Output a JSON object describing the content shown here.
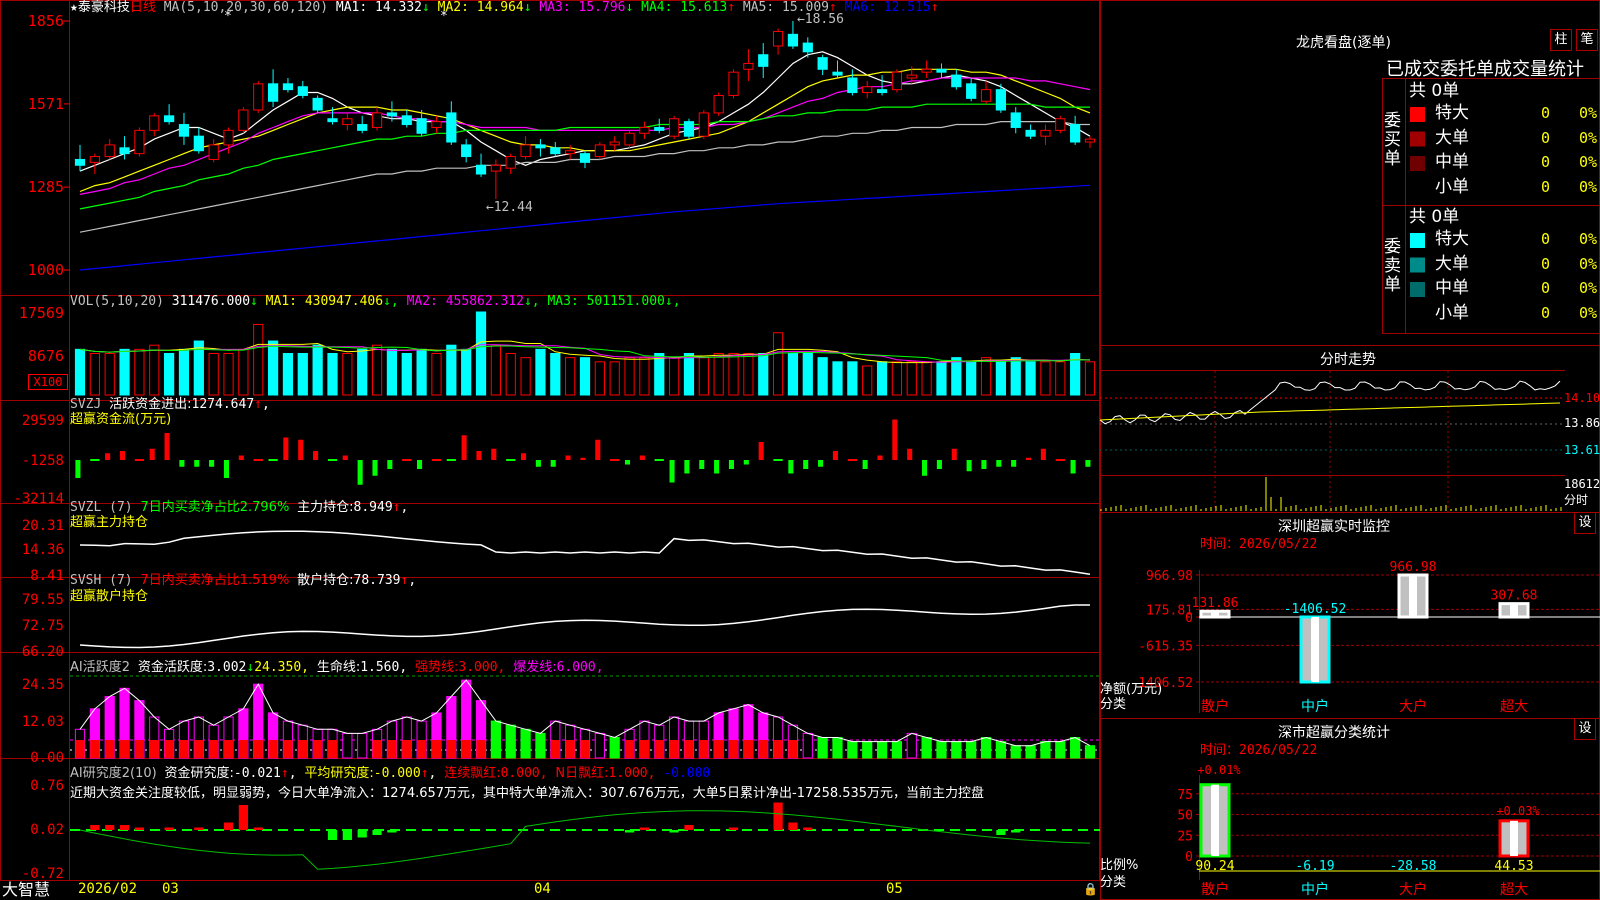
{
  "stock": {
    "name": "泰豪科技",
    "star": "★",
    "period": "日线"
  },
  "main_chart": {
    "ma_label": "MA(5,10,20,30,60,120)",
    "ma": [
      {
        "label": "MA1:",
        "value": "14.332",
        "arrow": "↓",
        "color": "#ffffff"
      },
      {
        "label": "MA2:",
        "value": "14.964",
        "arrow": "↓",
        "color": "#ffff00"
      },
      {
        "label": "MA3:",
        "value": "15.796",
        "arrow": "↓",
        "color": "#ff00ff"
      },
      {
        "label": "MA4:",
        "value": "15.613",
        "arrow": "↑",
        "color": "#00ff00"
      },
      {
        "label": "MA5:",
        "value": "15.009",
        "arrow": "↑",
        "color": "#c0c0c0"
      },
      {
        "label": "MA6:",
        "value": "12.515",
        "arrow": "↑",
        "color": "#0000ff"
      }
    ],
    "y_ticks": [
      "1856",
      "1571",
      "1285",
      "1000"
    ],
    "high_label": "18.56",
    "low_label": "12.44",
    "candles": [
      [
        13.8,
        14.3,
        13.4,
        13.6
      ],
      [
        13.7,
        14.0,
        13.3,
        13.9
      ],
      [
        13.9,
        14.5,
        13.8,
        14.3
      ],
      [
        14.2,
        14.6,
        13.8,
        14.0
      ],
      [
        14.0,
        14.9,
        13.9,
        14.8
      ],
      [
        14.8,
        15.4,
        14.6,
        15.3
      ],
      [
        15.3,
        15.7,
        15.0,
        15.1
      ],
      [
        15.0,
        15.4,
        14.3,
        14.6
      ],
      [
        14.6,
        14.9,
        14.0,
        14.1
      ],
      [
        13.8,
        14.5,
        13.7,
        14.3
      ],
      [
        14.3,
        14.9,
        14.0,
        14.8
      ],
      [
        14.8,
        15.6,
        14.7,
        15.5
      ],
      [
        15.5,
        16.5,
        15.4,
        16.4
      ],
      [
        16.4,
        16.9,
        15.6,
        15.8
      ],
      [
        16.4,
        16.6,
        16.1,
        16.2
      ],
      [
        16.3,
        16.5,
        15.9,
        16.0
      ],
      [
        15.9,
        16.0,
        15.4,
        15.5
      ],
      [
        15.2,
        15.6,
        15.0,
        15.1
      ],
      [
        15.0,
        15.4,
        14.8,
        15.2
      ],
      [
        15.0,
        15.3,
        14.7,
        14.8
      ],
      [
        14.9,
        15.6,
        14.8,
        15.4
      ],
      [
        15.4,
        15.8,
        15.1,
        15.3
      ],
      [
        15.3,
        15.5,
        14.9,
        15.0
      ],
      [
        15.2,
        15.5,
        14.6,
        14.7
      ],
      [
        14.9,
        15.3,
        14.7,
        15.1
      ],
      [
        15.4,
        15.8,
        14.3,
        14.4
      ],
      [
        14.3,
        14.5,
        13.7,
        13.9
      ],
      [
        13.6,
        14.0,
        13.2,
        13.3
      ],
      [
        13.4,
        13.8,
        12.44,
        13.6
      ],
      [
        13.5,
        14.0,
        13.3,
        13.9
      ],
      [
        13.9,
        14.6,
        13.8,
        14.3
      ],
      [
        14.3,
        14.5,
        13.9,
        14.2
      ],
      [
        14.2,
        14.4,
        13.9,
        14.0
      ],
      [
        14.0,
        14.3,
        13.8,
        14.1
      ],
      [
        14.0,
        14.1,
        13.5,
        13.7
      ],
      [
        13.9,
        14.4,
        13.8,
        14.3
      ],
      [
        14.3,
        14.6,
        14.1,
        14.4
      ],
      [
        14.3,
        14.8,
        14.2,
        14.7
      ],
      [
        14.7,
        15.1,
        14.5,
        14.9
      ],
      [
        14.9,
        15.2,
        14.7,
        14.8
      ],
      [
        14.6,
        15.3,
        14.5,
        15.2
      ],
      [
        15.1,
        15.2,
        14.5,
        14.6
      ],
      [
        14.6,
        15.5,
        14.5,
        15.4
      ],
      [
        15.4,
        16.1,
        15.3,
        16.0
      ],
      [
        16.0,
        16.9,
        15.9,
        16.8
      ],
      [
        16.9,
        17.6,
        16.5,
        17.1
      ],
      [
        17.4,
        17.8,
        16.6,
        17.0
      ],
      [
        17.7,
        18.3,
        17.4,
        18.2
      ],
      [
        18.1,
        18.56,
        17.6,
        17.7
      ],
      [
        17.8,
        18.0,
        17.3,
        17.5
      ],
      [
        17.3,
        17.4,
        16.7,
        16.9
      ],
      [
        16.8,
        17.2,
        16.6,
        16.7
      ],
      [
        16.6,
        16.9,
        16.0,
        16.1
      ],
      [
        16.1,
        16.5,
        15.9,
        16.3
      ],
      [
        16.2,
        16.7,
        16.0,
        16.1
      ],
      [
        16.2,
        16.9,
        16.1,
        16.8
      ],
      [
        16.6,
        17.0,
        16.4,
        16.7
      ],
      [
        16.8,
        17.2,
        16.6,
        16.9
      ],
      [
        16.9,
        17.1,
        16.6,
        16.8
      ],
      [
        16.7,
        16.9,
        16.2,
        16.3
      ],
      [
        16.4,
        16.6,
        15.8,
        15.9
      ],
      [
        15.8,
        16.5,
        15.7,
        16.2
      ],
      [
        16.2,
        16.4,
        15.4,
        15.5
      ],
      [
        15.4,
        15.6,
        14.7,
        14.9
      ],
      [
        14.8,
        15.0,
        14.5,
        14.6
      ],
      [
        14.6,
        15.0,
        14.3,
        14.8
      ],
      [
        14.8,
        15.3,
        14.7,
        15.2
      ],
      [
        15.0,
        15.3,
        14.3,
        14.4
      ],
      [
        14.4,
        14.6,
        14.2,
        14.5
      ]
    ],
    "ma_lines": [
      [
        13.4,
        13.6,
        13.8,
        14.0,
        14.2,
        14.5,
        14.7,
        14.9,
        14.9,
        14.7,
        14.5,
        14.7,
        15.1,
        15.5,
        15.8,
        16.1,
        16.1,
        15.9,
        15.6,
        15.4,
        15.3,
        15.2,
        15.2,
        15.1,
        15.1,
        15.1,
        14.8,
        14.4,
        14.1,
        13.8,
        13.6,
        13.8,
        13.9,
        14.0,
        14.1,
        14.1,
        14.1,
        14.2,
        14.3,
        14.5,
        14.7,
        14.8,
        14.9,
        15.1,
        15.4,
        15.7,
        16.1,
        16.6,
        17.1,
        17.4,
        17.5,
        17.3,
        17.0,
        16.7,
        16.5,
        16.4,
        16.4,
        16.5,
        16.6,
        16.7,
        16.6,
        16.5,
        16.3,
        16.0,
        15.7,
        15.4,
        15.1,
        14.9,
        14.6
      ],
      [
        12.7,
        12.9,
        13.0,
        13.2,
        13.4,
        13.6,
        13.8,
        14.0,
        14.2,
        14.3,
        14.4,
        14.5,
        14.6,
        14.8,
        15.0,
        15.2,
        15.4,
        15.5,
        15.6,
        15.6,
        15.6,
        15.5,
        15.5,
        15.4,
        15.3,
        15.2,
        15.0,
        14.8,
        14.6,
        14.4,
        14.3,
        14.3,
        14.2,
        14.2,
        14.1,
        14.1,
        14.1,
        14.1,
        14.2,
        14.3,
        14.4,
        14.5,
        14.6,
        14.7,
        14.9,
        15.1,
        15.4,
        15.7,
        16.0,
        16.3,
        16.5,
        16.6,
        16.7,
        16.7,
        16.8,
        16.8,
        16.9,
        16.9,
        16.9,
        16.9,
        16.8,
        16.8,
        16.7,
        16.5,
        16.3,
        16.1,
        15.9,
        15.6,
        15.4
      ],
      [
        12.6,
        12.7,
        12.8,
        13.0,
        13.1,
        13.3,
        13.5,
        13.6,
        13.8,
        14.0,
        14.2,
        14.4,
        14.7,
        14.9,
        15.1,
        15.3,
        15.4,
        15.4,
        15.4,
        15.4,
        15.4,
        15.3,
        15.2,
        15.2,
        15.1,
        15.1,
        15.0,
        14.9,
        14.9,
        14.9,
        14.9,
        14.8,
        14.8,
        14.8,
        14.8,
        14.8,
        14.8,
        14.8,
        14.8,
        14.8,
        14.9,
        14.9,
        14.9,
        15.0,
        15.0,
        15.1,
        15.2,
        15.4,
        15.6,
        15.8,
        15.9,
        16.1,
        16.2,
        16.3,
        16.3,
        16.4,
        16.5,
        16.5,
        16.6,
        16.6,
        16.6,
        16.6,
        16.6,
        16.6,
        16.5,
        16.5,
        16.4,
        16.3,
        16.2
      ],
      [
        12.1,
        12.2,
        12.3,
        12.4,
        12.5,
        12.7,
        12.8,
        12.9,
        13.1,
        13.2,
        13.3,
        13.5,
        13.6,
        13.8,
        13.9,
        14.0,
        14.1,
        14.2,
        14.3,
        14.4,
        14.5,
        14.5,
        14.6,
        14.6,
        14.7,
        14.7,
        14.8,
        14.8,
        14.8,
        14.8,
        14.8,
        14.8,
        14.8,
        14.9,
        14.9,
        14.9,
        14.9,
        14.9,
        14.9,
        15.0,
        15.0,
        15.0,
        15.0,
        15.1,
        15.1,
        15.1,
        15.2,
        15.3,
        15.3,
        15.4,
        15.4,
        15.5,
        15.5,
        15.5,
        15.6,
        15.6,
        15.6,
        15.7,
        15.7,
        15.7,
        15.7,
        15.7,
        15.7,
        15.7,
        15.7,
        15.6,
        15.6,
        15.6,
        15.6
      ],
      [
        11.3,
        11.4,
        11.5,
        11.6,
        11.7,
        11.8,
        11.9,
        12.0,
        12.1,
        12.2,
        12.3,
        12.4,
        12.5,
        12.6,
        12.7,
        12.8,
        12.9,
        13.0,
        13.1,
        13.2,
        13.3,
        13.3,
        13.4,
        13.4,
        13.5,
        13.5,
        13.5,
        13.6,
        13.6,
        13.6,
        13.7,
        13.7,
        13.7,
        13.8,
        13.8,
        13.8,
        13.9,
        13.9,
        13.9,
        14.0,
        14.0,
        14.1,
        14.1,
        14.2,
        14.2,
        14.3,
        14.3,
        14.4,
        14.4,
        14.5,
        14.6,
        14.6,
        14.7,
        14.7,
        14.8,
        14.8,
        14.9,
        14.9,
        14.9,
        15.0,
        15.0,
        15.0,
        15.1,
        15.1,
        15.1,
        15.1,
        15.1,
        15.0,
        15.0
      ],
      [
        10.0,
        10.05,
        10.1,
        10.15,
        10.2,
        10.25,
        10.3,
        10.35,
        10.4,
        10.45,
        10.5,
        10.55,
        10.6,
        10.65,
        10.7,
        10.75,
        10.8,
        10.85,
        10.9,
        10.95,
        11.0,
        11.05,
        11.1,
        11.15,
        11.2,
        11.25,
        11.3,
        11.35,
        11.4,
        11.45,
        11.5,
        11.55,
        11.6,
        11.65,
        11.7,
        11.75,
        11.8,
        11.85,
        11.9,
        11.95,
        12.0,
        12.04,
        12.08,
        12.12,
        12.16,
        12.2,
        12.24,
        12.28,
        12.31,
        12.34,
        12.37,
        12.4,
        12.43,
        12.46,
        12.49,
        12.52,
        12.55,
        12.58,
        12.61,
        12.64,
        12.67,
        12.7,
        12.73,
        12.76,
        12.79,
        12.82,
        12.85,
        12.88,
        12.91
      ]
    ]
  },
  "volume_panel": {
    "title": "VOL(5,10,20)",
    "value": "311476.000",
    "arrow": "↓",
    "ma": [
      {
        "label": "MA1:",
        "value": "430947.406",
        "arrow": "↓",
        "color": "#ffff00"
      },
      {
        "label": "MA2:",
        "value": "455862.312",
        "arrow": "↓",
        "color": "#ff00ff"
      },
      {
        "label": "MA3:",
        "value": "501151.000",
        "arrow": "↓",
        "color": "#00ff00"
      }
    ],
    "y_ticks": [
      "17569",
      "8676"
    ],
    "unit_badge": "X100",
    "bars": [
      0.55,
      0.5,
      0.5,
      0.55,
      0.55,
      0.6,
      0.5,
      0.55,
      0.65,
      0.5,
      0.5,
      0.55,
      0.85,
      0.65,
      0.5,
      0.5,
      0.6,
      0.5,
      0.5,
      0.55,
      0.6,
      0.55,
      0.5,
      0.55,
      0.5,
      0.6,
      0.55,
      1.0,
      0.6,
      0.5,
      0.45,
      0.55,
      0.5,
      0.45,
      0.45,
      0.4,
      0.4,
      0.45,
      0.45,
      0.5,
      0.45,
      0.5,
      0.45,
      0.5,
      0.5,
      0.5,
      0.5,
      0.75,
      0.5,
      0.5,
      0.45,
      0.4,
      0.4,
      0.35,
      0.4,
      0.4,
      0.4,
      0.4,
      0.4,
      0.45,
      0.4,
      0.45,
      0.4,
      0.45,
      0.4,
      0.4,
      0.4,
      0.5,
      0.4
    ]
  },
  "svzj_panel": {
    "title": "SVZJ",
    "line1": "活跃资金进出:",
    "value": "1274.647",
    "arrow": "↑",
    "subtitle": "超赢资金流(万元)",
    "y_ticks": [
      "29599",
      "-1258",
      "-32114"
    ],
    "bars": [
      -0.4,
      0.0,
      0.15,
      0.2,
      0.0,
      0.25,
      0.6,
      -0.15,
      -0.15,
      -0.15,
      -0.4,
      0.1,
      0.0,
      0.0,
      0.5,
      0.45,
      0.2,
      0.0,
      0.1,
      -0.55,
      -0.35,
      -0.2,
      0.0,
      -0.2,
      0.0,
      0.0,
      0.55,
      0.2,
      0.25,
      0.0,
      0.15,
      -0.15,
      -0.15,
      0.1,
      0.05,
      0.45,
      0.0,
      -0.1,
      0.1,
      0.0,
      -0.5,
      -0.3,
      -0.2,
      -0.3,
      -0.2,
      -0.1,
      0.4,
      0.0,
      -0.3,
      -0.2,
      -0.15,
      0.2,
      0.0,
      -0.2,
      0.1,
      0.9,
      0.25,
      -0.35,
      -0.2,
      0.25,
      -0.25,
      -0.2,
      -0.15,
      -0.15,
      0.05,
      0.25,
      0.0,
      -0.3,
      -0.15,
      0.0,
      -0.2,
      -0.15,
      0.1,
      -0.1
    ]
  },
  "svzl_panel": {
    "title": "SVZL (7)",
    "desc": "7日内买卖净占比2.796%",
    "label": "主力持仓:",
    "value": "8.949",
    "arrow": "↑",
    "subtitle": "超赢主力持仓",
    "y_ticks": [
      "20.31",
      "14.36",
      "8.41"
    ]
  },
  "svsh_panel": {
    "title": "SVSH (7)",
    "desc": "7日内买卖净占比1.519%",
    "label": "散户持仓:",
    "value": "78.739",
    "arrow": "↑",
    "subtitle": "超赢散户持仓",
    "y_ticks": [
      "79.55",
      "72.75",
      "66.20"
    ]
  },
  "ai_activity_panel": {
    "title": "AI活跃度2",
    "label": "资金活跃度:",
    "value": "3.002",
    "arrow": "↓",
    "v2": "24.350,",
    "life_label": "生命线:",
    "life_value": "1.560,",
    "strong_label": "强势线:",
    "strong_value": "3.000,",
    "burst_label": "爆发线:",
    "burst_value": "6.000,",
    "y_ticks": [
      "24.35",
      "12.03",
      "0.00"
    ]
  },
  "ai_research_panel": {
    "title": "AI研究度2(10)",
    "label": "资金研究度:",
    "value": "-0.021",
    "arrow": "↑",
    "avg_label": "平均研究度:",
    "avg_value": "-0.000",
    "red_label": "连续飘红:",
    "red_value": "0.000,",
    "nred_label": "N日飘红:",
    "nred_value": "1.000,",
    "extra_value": "-0.000",
    "comment": "近期大资金关注度较低，明显弱势，今日大单净流入：1274.657万元，其中特大单净流入：307.676万元，大单5日累计净出-17258.535万元，当前主力控盘",
    "y_ticks": [
      "0.76",
      "0.02",
      "-0.72"
    ]
  },
  "footer": {
    "brand": "大智慧",
    "dates": [
      "2026/02",
      "03",
      "04",
      "05"
    ]
  },
  "lhb": {
    "title": "龙虎看盘(逐单)",
    "btn_zhu": "柱",
    "btn_bi": "笔",
    "tabs": "已成交委托单成交量统计",
    "buy_label": "委买单",
    "sell_label": "委卖单",
    "buy_total": "共 0单",
    "sell_total": "共 0单",
    "buy_rows": [
      {
        "label": "特大",
        "value": "0",
        "pct": "0%",
        "color": "#ff0000"
      },
      {
        "label": "大单",
        "value": "0",
        "pct": "0%",
        "color": "#a00000"
      },
      {
        "label": "中单",
        "value": "0",
        "pct": "0%",
        "color": "#700000"
      },
      {
        "label": "小单",
        "value": "0",
        "pct": "0%",
        "color": ""
      }
    ],
    "sell_rows": [
      {
        "label": "特大",
        "value": "0",
        "pct": "0%",
        "color": "#00ffff"
      },
      {
        "label": "大单",
        "value": "0",
        "pct": "0%",
        "color": "#008b8b"
      },
      {
        "label": "中单",
        "value": "0",
        "pct": "0%",
        "color": "#006b6b"
      },
      {
        "label": "小单",
        "value": "0",
        "pct": "0%",
        "color": ""
      }
    ]
  },
  "intraday": {
    "title": "分时走势",
    "ticks": [
      "14.10",
      "13.86",
      "13.61",
      "18612",
      "分时"
    ]
  },
  "sz_monitor": {
    "title": "深圳超赢实时监控",
    "settings_label": "设",
    "time_label": "时间：",
    "date": "2026/05/22",
    "y_ticks": [
      "966.98",
      "175.81",
      "0",
      "-615.35",
      "-1406.52"
    ],
    "axis_label_1": "净额(万元)",
    "axis_label_2": "分类",
    "categories": [
      "散户",
      "中户",
      "大户",
      "超大"
    ],
    "values": [
      131.86,
      -1406.52,
      966.98,
      307.68
    ],
    "value_labels": [
      "131.86",
      "-1406.52",
      "966.98",
      "307.68"
    ]
  },
  "sz_classify": {
    "title": "深市超赢分类统计",
    "settings_label": "设",
    "time_label": "时间：",
    "date": "2026/05/22",
    "y_ticks": [
      "75",
      "50",
      "25",
      "0"
    ],
    "axis_label_1": "比例%",
    "axis_label_2": "分类",
    "categories": [
      "散户",
      "中户",
      "大户",
      "超大"
    ],
    "values": [
      90.24,
      -6.19,
      -28.58,
      44.53
    ],
    "bottom_labels": [
      "90.24",
      "-6.19",
      "-28.58",
      "44.53"
    ],
    "top_labels": [
      "+0.01%",
      "",
      "",
      "+0.03%"
    ]
  }
}
